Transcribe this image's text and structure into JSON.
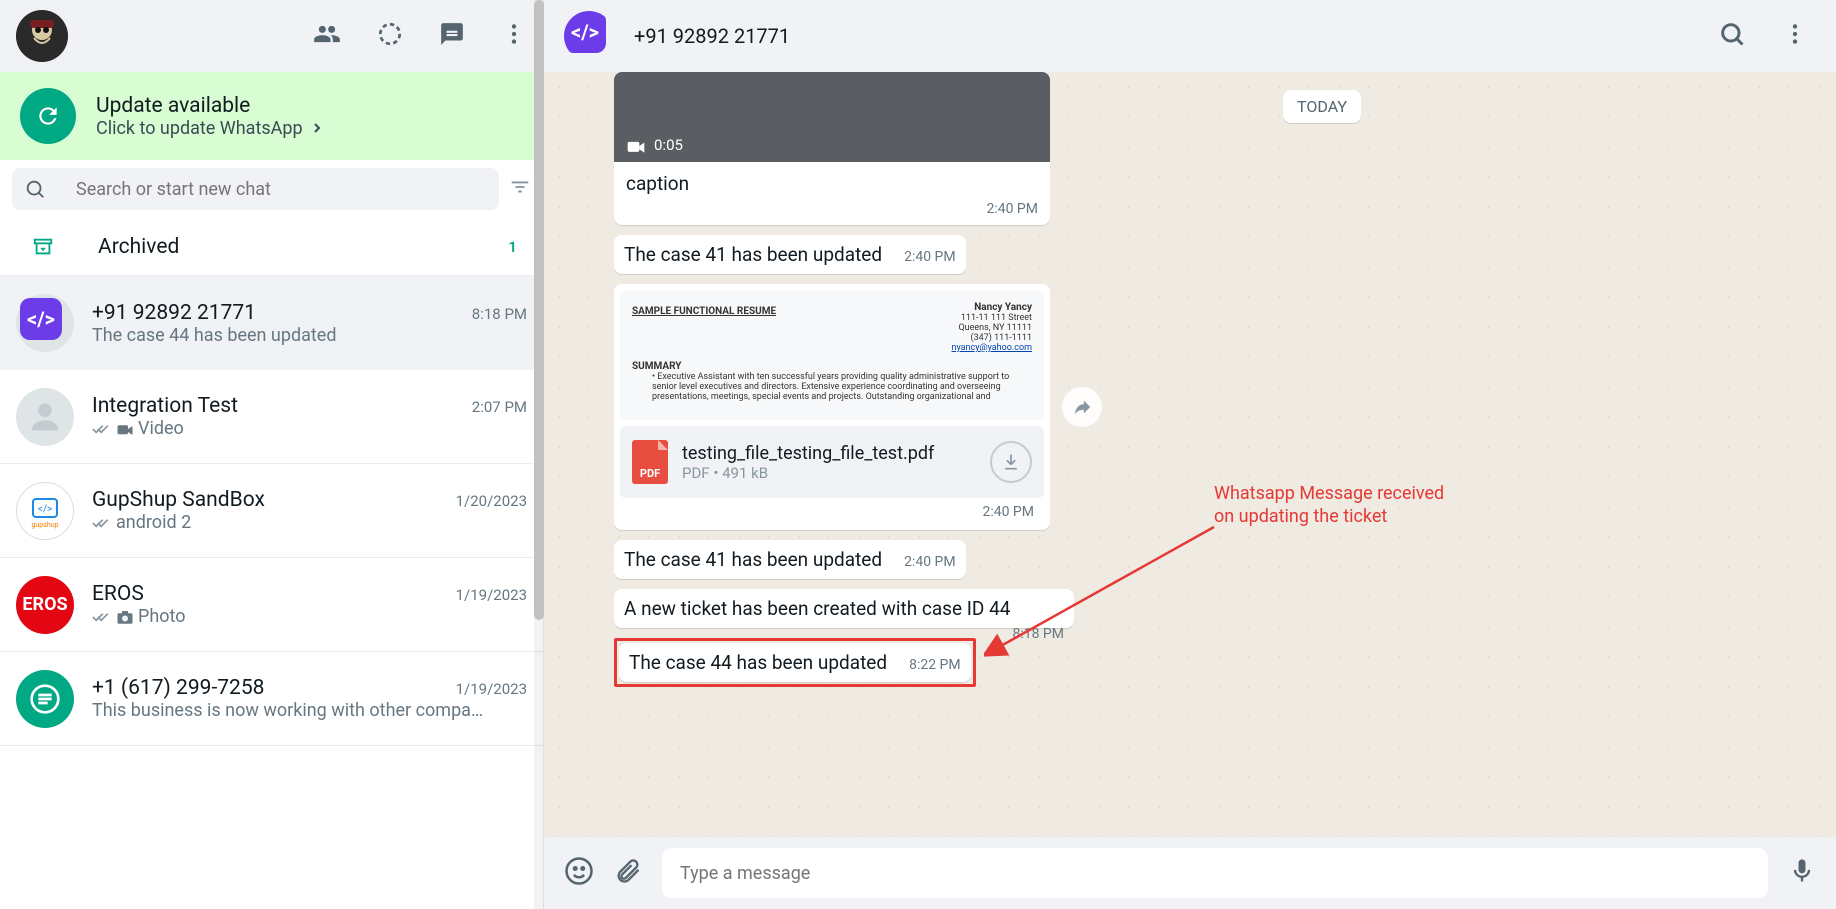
{
  "update": {
    "title": "Update available",
    "subtitle": "Click to update WhatsApp"
  },
  "search": {
    "placeholder": "Search or start new chat"
  },
  "archived": {
    "label": "Archived",
    "count": "1"
  },
  "chats": [
    {
      "name": "+91 92892 21771",
      "time": "8:18 PM",
      "preview": "The case 44 has been updated"
    },
    {
      "name": "Integration Test",
      "time": "2:07 PM",
      "preview": "Video"
    },
    {
      "name": "GupShup SandBox",
      "time": "1/20/2023",
      "preview": "android 2"
    },
    {
      "name": "EROS",
      "time": "1/19/2023",
      "preview": "Photo"
    },
    {
      "name": "+1 (617) 299-7258",
      "time": "1/19/2023",
      "preview": "This business is now working with other compa…"
    }
  ],
  "conversation": {
    "title": "+91 92892 21771",
    "dateChip": "TODAY",
    "videoMsg": {
      "duration": "0:05",
      "caption": "caption",
      "time": "2:40 PM"
    },
    "msg1": {
      "text": "The case 41 has been updated",
      "time": "2:40 PM"
    },
    "docMsg": {
      "previewTitle": "SAMPLE FUNCTIONAL RESUME",
      "previewName": "Nancy Yancy",
      "previewAddr1": "111-11 111 Street",
      "previewAddr2": "Queens, NY 11111",
      "previewPhone": "(347) 111-1111",
      "previewEmail": "nyancy@yahoo.com",
      "previewSummary": "SUMMARY",
      "previewBullet": "Executive Assistant with ten successful years providing quality administrative support to senior level executives and directors. Extensive experience coordinating and overseeing presentations, meetings, special events and projects. Outstanding organizational and",
      "fileName": "testing_file_testing_file_test.pdf",
      "fileMeta": "PDF • 491 kB",
      "pdfLabel": "PDF",
      "time": "2:40 PM"
    },
    "msg2": {
      "text": "The case 41 has been updated",
      "time": "2:40 PM"
    },
    "msg3": {
      "text": "A new ticket has been created with case ID 44",
      "time": "8:18 PM"
    },
    "msg4": {
      "text": "The case 44 has been updated",
      "time": "8:22 PM"
    }
  },
  "composer": {
    "placeholder": "Type a message"
  },
  "annotation": {
    "line1": "Whatsapp Message received",
    "line2": "on updating the ticket"
  }
}
